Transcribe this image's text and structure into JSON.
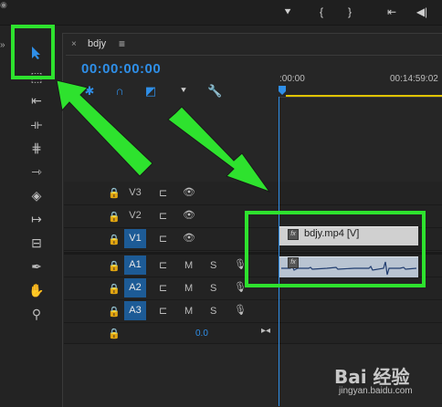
{
  "timeline": {
    "tab": {
      "close": "×",
      "name": "bdjy",
      "menu": "≡"
    },
    "timecode": "00:00:00:00",
    "ruler": {
      "start": ":00:00",
      "end": "00:14:59:02"
    },
    "tracks": [
      {
        "label": "V3",
        "kind": "video",
        "targeted": false
      },
      {
        "label": "V2",
        "kind": "video",
        "targeted": false
      },
      {
        "label": "V1",
        "kind": "video",
        "targeted": true
      },
      {
        "label": "A1",
        "kind": "audio",
        "targeted": true
      },
      {
        "label": "A2",
        "kind": "audio",
        "targeted": true
      },
      {
        "label": "A3",
        "kind": "audio",
        "targeted": true
      }
    ],
    "audio_buttons": {
      "mute": "M",
      "solo": "S"
    },
    "master_volume": "0.0",
    "clips": {
      "video": "bdjy.mp4 [V]"
    }
  },
  "icons": {
    "selection_tool": "selection-arrow-icon",
    "track_select": "track-select-icon",
    "ripple_edit": "ripple-edit-icon",
    "razor": "razor-icon",
    "hand": "hand-icon",
    "zoom": "zoom-icon",
    "pen": "pen-icon"
  },
  "colors": {
    "accent": "#2f8fe8",
    "highlight": "#2ee22e",
    "target": "#1d5b96",
    "work_area": "#e0c400"
  },
  "watermark": {
    "brand": "Bai 经验",
    "url": "jingyan.baidu.com"
  }
}
